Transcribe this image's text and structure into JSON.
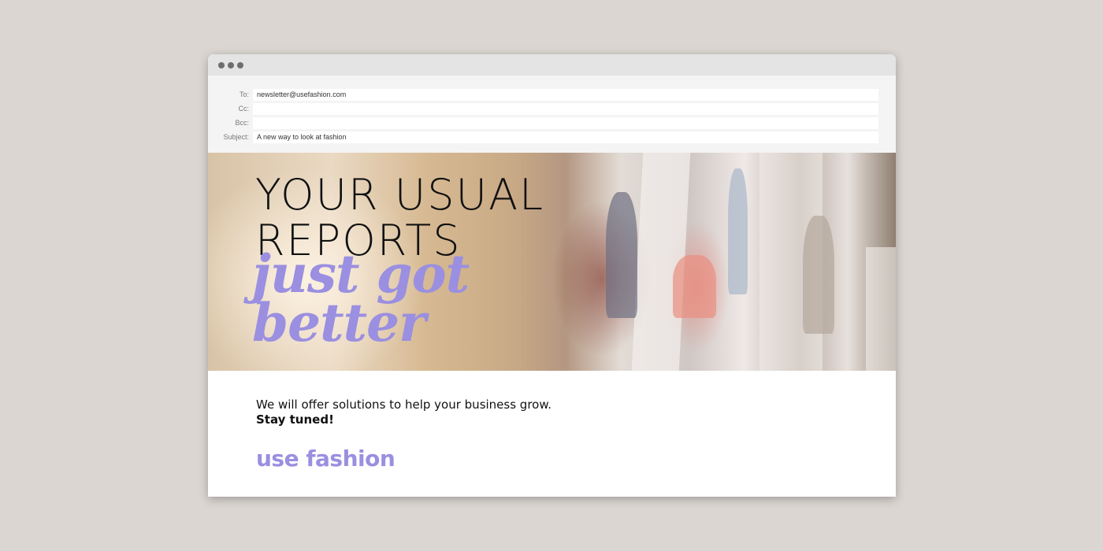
{
  "window": {
    "controls": [
      "close",
      "minimize",
      "maximize"
    ]
  },
  "email": {
    "to_label": "To:",
    "to_value": "newsletter@usefashion.com",
    "cc_label": "Cc:",
    "cc_value": "",
    "bcc_label": "Bcc:",
    "bcc_value": "",
    "subject_label": "Subject:",
    "subject_value": "A new way to look at fashion"
  },
  "hero": {
    "line1": "YOUR USUAL",
    "line2": "REPORTS",
    "script1": "just got",
    "script2": "better"
  },
  "body": {
    "message": "We will offer solutions to help your business grow.",
    "cta": "Stay tuned!",
    "logo": "use fashion"
  },
  "colors": {
    "accent": "#9a8fe0",
    "page_background": "#dbd6d2",
    "titlebar": "#e4e4e4",
    "header_area": "#f4f4f4"
  }
}
